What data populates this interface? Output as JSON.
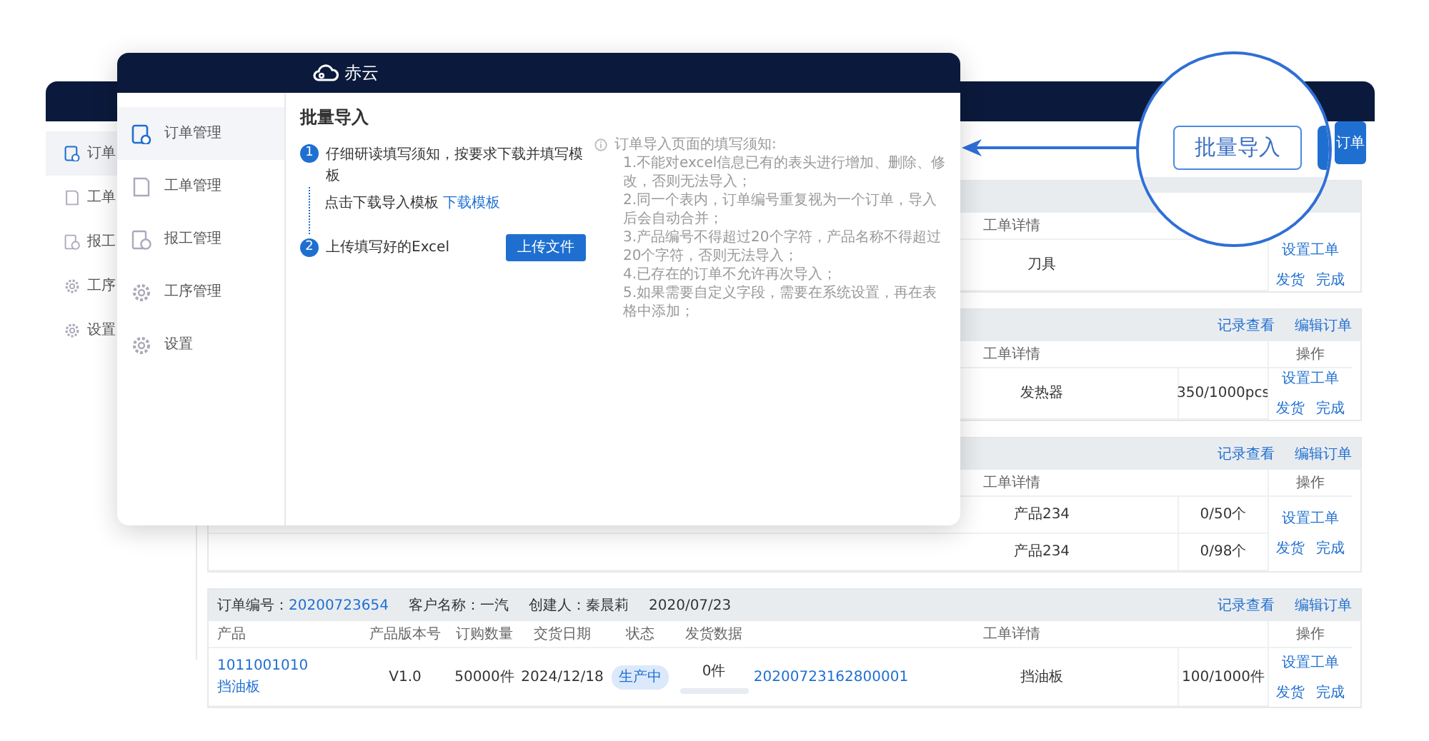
{
  "background_app": {
    "sidebar": [
      {
        "label": "订单",
        "selected": true
      },
      {
        "label": "工单",
        "selected": false
      },
      {
        "label": "报工",
        "selected": false
      },
      {
        "label": "工序",
        "selected": false
      },
      {
        "label": "设置",
        "selected": false
      }
    ],
    "toolbar_button": "订单",
    "orders": [
      {
        "columns": [
          "工单详情"
        ],
        "rows": [
          {
            "detail": "刀具"
          }
        ],
        "actions": [
          "设置工单",
          "发货",
          "完成"
        ]
      },
      {
        "links": [
          "记录查看",
          "编辑订单"
        ],
        "columns": [
          "工单详情",
          "操作"
        ],
        "rows": [
          {
            "detail": "发热器",
            "progress": "350/1000pcs"
          }
        ],
        "actions": [
          "设置工单",
          "发货",
          "完成"
        ]
      },
      {
        "links": [
          "记录查看",
          "编辑订单"
        ],
        "columns": [
          "工单详情",
          "操作"
        ],
        "rows": [
          {
            "detail": "产品234",
            "progress": "0/50个"
          },
          {
            "detail": "产品234",
            "progress": "0/98个"
          }
        ],
        "actions": [
          "设置工单",
          "发货",
          "完成"
        ]
      },
      {
        "meta": {
          "order_label": "订单编号：",
          "order_no": "20200723654",
          "customer": "客户名称：一汽",
          "creator": "创建人：秦晨莉",
          "date": "2020/07/23"
        },
        "links": [
          "记录查看",
          "编辑订单"
        ],
        "columns": [
          "产品",
          "产品版本号",
          "订购数量",
          "交货日期",
          "状态",
          "发货数据",
          "工单详情",
          "操作"
        ],
        "rows": [
          {
            "product_code": "1011001010",
            "product_name": "挡油板",
            "version": "V1.0",
            "quantity": "50000件",
            "delivery_date": "2024/12/18",
            "status": "生产中",
            "shipped": {
              "text": "0件",
              "level": 0
            },
            "work_order": "20200723162800001",
            "detail": "挡油板",
            "progress": "100/1000件"
          }
        ],
        "actions": [
          "设置工单",
          "发货",
          "完成"
        ]
      }
    ]
  },
  "import_dialog": {
    "brand": "赤云",
    "sidebar": [
      {
        "label": "订单管理",
        "selected": true
      },
      {
        "label": "工单管理",
        "selected": false
      },
      {
        "label": "报工管理",
        "selected": false
      },
      {
        "label": "工序管理",
        "selected": false
      },
      {
        "label": "设置",
        "selected": false
      }
    ],
    "title": "批量导入",
    "steps": [
      {
        "number": "1",
        "text": "仔细研读填写须知，按要求下载并填写模板",
        "hint": "点击下载导入模板",
        "link": "下载模板"
      },
      {
        "number": "2",
        "text": "上传填写好的Excel",
        "button": "上传文件"
      }
    ],
    "notes": {
      "title": "订单导入页面的填写须知:",
      "lines": [
        "1.不能对excel信息已有的表头进行增加、删除、修改，否则无法导入；",
        "2.同一个表内，订单编号重复视为一个订单，导入后会自动合并；",
        "3.产品编号不得超过20个字符，产品名称不得超过20个字符，否则无法导入；",
        "4.已存在的订单不允许再次导入；",
        "5.如果需要自定义字段，需要在系统设置，再在表格中添加；"
      ]
    }
  },
  "magnifier": {
    "button": "批量导入"
  }
}
